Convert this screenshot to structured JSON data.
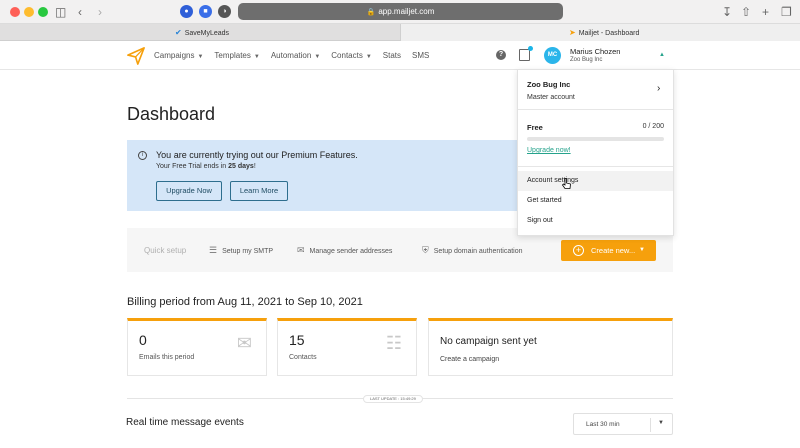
{
  "browser": {
    "url": "app.mailjet.com",
    "tabs": [
      {
        "label": "SaveMyLeads"
      },
      {
        "label": "Mailjet - Dashboard"
      }
    ]
  },
  "header": {
    "nav": [
      {
        "label": "Campaigns",
        "has_caret": true
      },
      {
        "label": "Templates",
        "has_caret": true
      },
      {
        "label": "Automation",
        "has_caret": true
      },
      {
        "label": "Contacts",
        "has_caret": true
      },
      {
        "label": "Stats",
        "has_caret": false
      },
      {
        "label": "SMS",
        "has_caret": false
      }
    ],
    "help_label": "?",
    "user": {
      "initials": "MC",
      "name": "Marius Chozen",
      "company": "Zoo Bug Inc"
    }
  },
  "dashboard": {
    "title": "Dashboard",
    "trial": {
      "title": "You are currently trying out our Premium Features.",
      "subtitle_prefix": "Your Free Trial ends in ",
      "subtitle_days": "25 days",
      "subtitle_suffix": "!",
      "upgrade_label": "Upgrade Now",
      "learn_label": "Learn More"
    },
    "quick_setup": {
      "label": "Quick setup",
      "items": [
        {
          "label": "Setup my SMTP",
          "icon": "sliders-icon"
        },
        {
          "label": "Manage sender addresses",
          "icon": "sender-icon"
        },
        {
          "label": "Setup domain authentication",
          "icon": "shield-icon"
        }
      ],
      "create_label": "Create new..."
    },
    "billing": {
      "title": "Billing period from Aug 11, 2021 to Sep 10, 2021",
      "emails_value": "0",
      "emails_label": "Emails this period",
      "contacts_value": "15",
      "contacts_label": "Contacts",
      "campaign_title": "No campaign sent yet",
      "campaign_link": "Create a campaign"
    },
    "last_update": "LAST UPDATE : 15:49:29",
    "realtime": {
      "title": "Real time message events",
      "period": "Last 30 min"
    }
  },
  "dropdown": {
    "account_name": "Zoo Bug Inc",
    "account_sub": "Master account",
    "plan_name": "Free",
    "plan_count": "0 / 200",
    "plan_usage_fraction": 0,
    "upgrade_link": "Upgrade now!",
    "items": [
      {
        "label": "Account settings"
      },
      {
        "label": "Get started"
      },
      {
        "label": "Sign out"
      }
    ]
  },
  "colors": {
    "accent": "#26a38c",
    "brand_orange": "#f6a00c",
    "avatar": "#2bb5ea",
    "banner": "#d5e6f8"
  }
}
